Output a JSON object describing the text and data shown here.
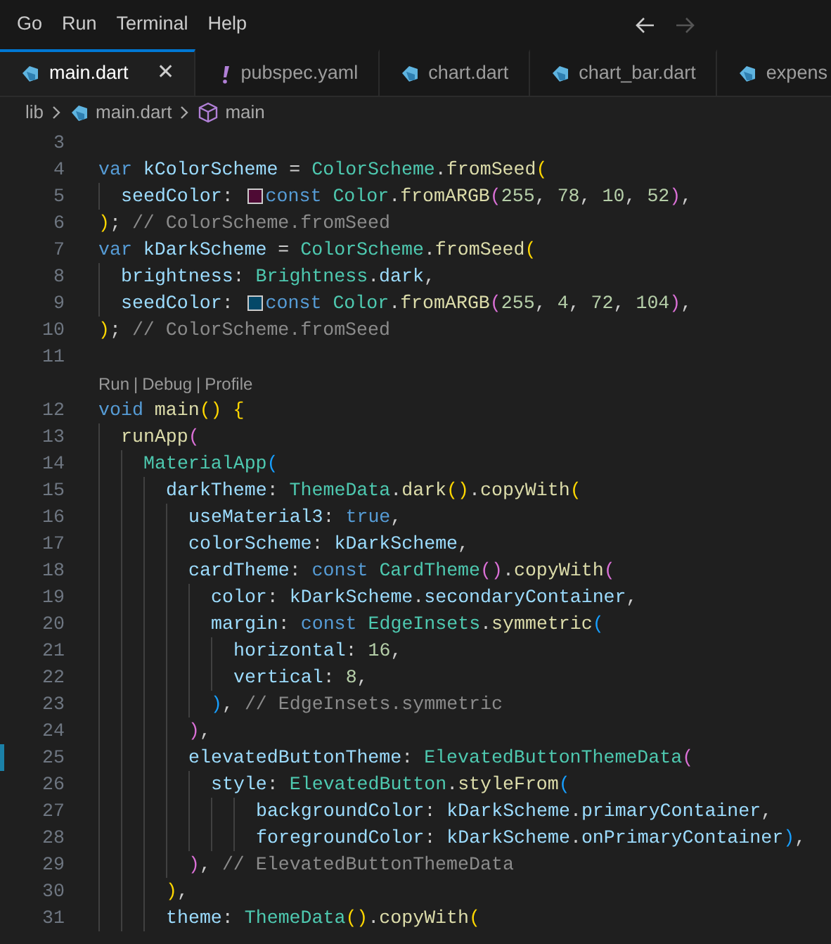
{
  "menu": [
    {
      "label": "Go"
    },
    {
      "label": "Run"
    },
    {
      "label": "Terminal"
    },
    {
      "label": "Help"
    }
  ],
  "navigation": {
    "back_disabled": false,
    "forward_disabled": true
  },
  "tabs": [
    {
      "label": "main.dart",
      "kind": "dart",
      "selected": true,
      "close": "✕"
    },
    {
      "label": "pubspec.yaml",
      "kind": "yaml",
      "selected": false
    },
    {
      "label": "chart.dart",
      "kind": "dart",
      "selected": false
    },
    {
      "label": "chart_bar.dart",
      "kind": "dart",
      "selected": false
    },
    {
      "label": "expens",
      "kind": "dart",
      "selected": false
    }
  ],
  "breadcrumb": [
    {
      "label": "lib",
      "kind": "folder"
    },
    {
      "label": "main.dart",
      "kind": "dart"
    },
    {
      "label": "main",
      "kind": "symbol"
    }
  ],
  "editor": {
    "lines": [
      {
        "number": "3",
        "modified": false
      },
      {
        "number": "4",
        "modified": false,
        "tokens": [
          {
            "kind": "kw",
            "text": "var "
          },
          {
            "kind": "var",
            "text": "kColorScheme"
          },
          {
            "kind": "plain",
            "text": " = "
          },
          {
            "kind": "type",
            "text": "ColorScheme"
          },
          {
            "kind": "plain",
            "text": "."
          },
          {
            "kind": "fn",
            "text": "fromSeed"
          },
          {
            "kind": "p1",
            "text": "("
          }
        ]
      },
      {
        "number": "5",
        "modified": false,
        "tokens": [
          {
            "kind": "var",
            "text": "  seedColor"
          },
          {
            "kind": "plain",
            "text": ": "
          },
          {
            "kind": "swatch",
            "color": "#4e0a34"
          },
          {
            "kind": "kw",
            "text": "const "
          },
          {
            "kind": "type",
            "text": "Color"
          },
          {
            "kind": "plain",
            "text": "."
          },
          {
            "kind": "fn",
            "text": "fromARGB"
          },
          {
            "kind": "p2",
            "text": "("
          },
          {
            "kind": "num",
            "text": "255"
          },
          {
            "kind": "plain",
            "text": ", "
          },
          {
            "kind": "num",
            "text": "78"
          },
          {
            "kind": "plain",
            "text": ", "
          },
          {
            "kind": "num",
            "text": "10"
          },
          {
            "kind": "plain",
            "text": ", "
          },
          {
            "kind": "num",
            "text": "52"
          },
          {
            "kind": "p2",
            "text": ")"
          },
          {
            "kind": "plain",
            "text": ","
          }
        ]
      },
      {
        "number": "6",
        "modified": false,
        "tokens": [
          {
            "kind": "p1",
            "text": ")"
          },
          {
            "kind": "plain",
            "text": "; "
          },
          {
            "kind": "cmt",
            "text": "// ColorScheme.fromSeed"
          }
        ]
      },
      {
        "number": "7",
        "modified": false,
        "tokens": [
          {
            "kind": "kw",
            "text": "var "
          },
          {
            "kind": "var",
            "text": "kDarkScheme"
          },
          {
            "kind": "plain",
            "text": " = "
          },
          {
            "kind": "type",
            "text": "ColorScheme"
          },
          {
            "kind": "plain",
            "text": "."
          },
          {
            "kind": "fn",
            "text": "fromSeed"
          },
          {
            "kind": "p1",
            "text": "("
          }
        ]
      },
      {
        "number": "8",
        "modified": false,
        "tokens": [
          {
            "kind": "var",
            "text": "  brightness"
          },
          {
            "kind": "plain",
            "text": ": "
          },
          {
            "kind": "type",
            "text": "Brightness"
          },
          {
            "kind": "plain",
            "text": "."
          },
          {
            "kind": "var",
            "text": "dark"
          },
          {
            "kind": "plain",
            "text": ","
          }
        ]
      },
      {
        "number": "9",
        "modified": false,
        "tokens": [
          {
            "kind": "var",
            "text": "  seedColor"
          },
          {
            "kind": "plain",
            "text": ": "
          },
          {
            "kind": "swatch",
            "color": "#044868"
          },
          {
            "kind": "kw",
            "text": "const "
          },
          {
            "kind": "type",
            "text": "Color"
          },
          {
            "kind": "plain",
            "text": "."
          },
          {
            "kind": "fn",
            "text": "fromARGB"
          },
          {
            "kind": "p2",
            "text": "("
          },
          {
            "kind": "num",
            "text": "255"
          },
          {
            "kind": "plain",
            "text": ", "
          },
          {
            "kind": "num",
            "text": "4"
          },
          {
            "kind": "plain",
            "text": ", "
          },
          {
            "kind": "num",
            "text": "72"
          },
          {
            "kind": "plain",
            "text": ", "
          },
          {
            "kind": "num",
            "text": "104"
          },
          {
            "kind": "p2",
            "text": ")"
          },
          {
            "kind": "plain",
            "text": ","
          }
        ]
      },
      {
        "number": "10",
        "modified": false,
        "tokens": [
          {
            "kind": "p1",
            "text": ")"
          },
          {
            "kind": "plain",
            "text": "; "
          },
          {
            "kind": "cmt",
            "text": "// ColorScheme.fromSeed"
          }
        ]
      },
      {
        "number": "11",
        "modified": false
      },
      {
        "number": "12",
        "modified": false,
        "codelens": [
          "Run",
          "Debug",
          "Profile"
        ],
        "separator": "|",
        "tokens": [
          {
            "kind": "kw",
            "text": "void "
          },
          {
            "kind": "fn",
            "text": "main"
          },
          {
            "kind": "p1",
            "text": "() {"
          }
        ]
      },
      {
        "number": "13",
        "modified": false,
        "tokens": [
          {
            "kind": "fn",
            "text": "  runApp"
          },
          {
            "kind": "p2",
            "text": "("
          }
        ]
      },
      {
        "number": "14",
        "modified": false,
        "tokens": [
          {
            "kind": "type",
            "text": "    MaterialApp"
          },
          {
            "kind": "p3",
            "text": "("
          }
        ]
      },
      {
        "number": "15",
        "modified": false,
        "tokens": [
          {
            "kind": "var",
            "text": "      darkTheme"
          },
          {
            "kind": "plain",
            "text": ": "
          },
          {
            "kind": "type",
            "text": "ThemeData"
          },
          {
            "kind": "plain",
            "text": "."
          },
          {
            "kind": "fn",
            "text": "dark"
          },
          {
            "kind": "p1",
            "text": "()"
          },
          {
            "kind": "plain",
            "text": "."
          },
          {
            "kind": "fn",
            "text": "copyWith"
          },
          {
            "kind": "p1",
            "text": "("
          }
        ]
      },
      {
        "number": "16",
        "modified": false,
        "tokens": [
          {
            "kind": "var",
            "text": "        useMaterial3"
          },
          {
            "kind": "plain",
            "text": ": "
          },
          {
            "kind": "kw",
            "text": "true"
          },
          {
            "kind": "plain",
            "text": ","
          }
        ]
      },
      {
        "number": "17",
        "modified": false,
        "tokens": [
          {
            "kind": "var",
            "text": "        colorScheme"
          },
          {
            "kind": "plain",
            "text": ": "
          },
          {
            "kind": "var",
            "text": "kDarkScheme"
          },
          {
            "kind": "plain",
            "text": ","
          }
        ]
      },
      {
        "number": "18",
        "modified": false,
        "tokens": [
          {
            "kind": "var",
            "text": "        cardTheme"
          },
          {
            "kind": "plain",
            "text": ": "
          },
          {
            "kind": "kw",
            "text": "const "
          },
          {
            "kind": "type",
            "text": "CardTheme"
          },
          {
            "kind": "p2",
            "text": "()"
          },
          {
            "kind": "plain",
            "text": "."
          },
          {
            "kind": "fn",
            "text": "copyWith"
          },
          {
            "kind": "p2",
            "text": "("
          }
        ]
      },
      {
        "number": "19",
        "modified": false,
        "tokens": [
          {
            "kind": "var",
            "text": "          color"
          },
          {
            "kind": "plain",
            "text": ": "
          },
          {
            "kind": "var",
            "text": "kDarkScheme"
          },
          {
            "kind": "plain",
            "text": "."
          },
          {
            "kind": "var",
            "text": "secondaryContainer"
          },
          {
            "kind": "plain",
            "text": ","
          }
        ]
      },
      {
        "number": "20",
        "modified": false,
        "tokens": [
          {
            "kind": "var",
            "text": "          margin"
          },
          {
            "kind": "plain",
            "text": ": "
          },
          {
            "kind": "kw",
            "text": "const "
          },
          {
            "kind": "type",
            "text": "EdgeInsets"
          },
          {
            "kind": "plain",
            "text": "."
          },
          {
            "kind": "fn",
            "text": "symmetric"
          },
          {
            "kind": "p3",
            "text": "("
          }
        ]
      },
      {
        "number": "21",
        "modified": false,
        "tokens": [
          {
            "kind": "var",
            "text": "            horizontal"
          },
          {
            "kind": "plain",
            "text": ": "
          },
          {
            "kind": "num",
            "text": "16"
          },
          {
            "kind": "plain",
            "text": ","
          }
        ]
      },
      {
        "number": "22",
        "modified": false,
        "tokens": [
          {
            "kind": "var",
            "text": "            vertical"
          },
          {
            "kind": "plain",
            "text": ": "
          },
          {
            "kind": "num",
            "text": "8"
          },
          {
            "kind": "plain",
            "text": ","
          }
        ]
      },
      {
        "number": "23",
        "modified": false,
        "tokens": [
          {
            "kind": "p3",
            "text": "          )"
          },
          {
            "kind": "plain",
            "text": ", "
          },
          {
            "kind": "cmt",
            "text": "// EdgeInsets.symmetric"
          }
        ]
      },
      {
        "number": "24",
        "modified": false,
        "tokens": [
          {
            "kind": "p2",
            "text": "        )"
          },
          {
            "kind": "plain",
            "text": ","
          }
        ]
      },
      {
        "number": "25",
        "modified": true,
        "tokens": [
          {
            "kind": "var",
            "text": "        elevatedButtonTheme"
          },
          {
            "kind": "plain",
            "text": ": "
          },
          {
            "kind": "type",
            "text": "ElevatedButtonThemeData"
          },
          {
            "kind": "p2",
            "text": "("
          }
        ]
      },
      {
        "number": "26",
        "modified": false,
        "tokens": [
          {
            "kind": "var",
            "text": "          style"
          },
          {
            "kind": "plain",
            "text": ": "
          },
          {
            "kind": "type",
            "text": "ElevatedButton"
          },
          {
            "kind": "plain",
            "text": "."
          },
          {
            "kind": "fn",
            "text": "styleFrom"
          },
          {
            "kind": "p3",
            "text": "("
          }
        ]
      },
      {
        "number": "27",
        "modified": false,
        "tokens": [
          {
            "kind": "var",
            "text": "              backgroundColor"
          },
          {
            "kind": "plain",
            "text": ": "
          },
          {
            "kind": "var",
            "text": "kDarkScheme"
          },
          {
            "kind": "plain",
            "text": "."
          },
          {
            "kind": "var",
            "text": "primaryContainer"
          },
          {
            "kind": "plain",
            "text": ","
          }
        ]
      },
      {
        "number": "28",
        "modified": false,
        "tokens": [
          {
            "kind": "var",
            "text": "              foregroundColor"
          },
          {
            "kind": "plain",
            "text": ": "
          },
          {
            "kind": "var",
            "text": "kDarkScheme"
          },
          {
            "kind": "plain",
            "text": "."
          },
          {
            "kind": "var",
            "text": "onPrimaryContainer"
          },
          {
            "kind": "p3",
            "text": ")"
          },
          {
            "kind": "plain",
            "text": ","
          }
        ]
      },
      {
        "number": "29",
        "modified": false,
        "tokens": [
          {
            "kind": "p2",
            "text": "        )"
          },
          {
            "kind": "plain",
            "text": ", "
          },
          {
            "kind": "cmt",
            "text": "// ElevatedButtonThemeData"
          }
        ]
      },
      {
        "number": "30",
        "modified": false,
        "tokens": [
          {
            "kind": "p1",
            "text": "      )"
          },
          {
            "kind": "plain",
            "text": ","
          }
        ]
      },
      {
        "number": "31",
        "modified": false,
        "tokens": [
          {
            "kind": "var",
            "text": "      theme"
          },
          {
            "kind": "plain",
            "text": ": "
          },
          {
            "kind": "type",
            "text": "ThemeData"
          },
          {
            "kind": "p1",
            "text": "()"
          },
          {
            "kind": "plain",
            "text": "."
          },
          {
            "kind": "fn",
            "text": "copyWith"
          },
          {
            "kind": "p1",
            "text": "("
          }
        ]
      }
    ]
  }
}
